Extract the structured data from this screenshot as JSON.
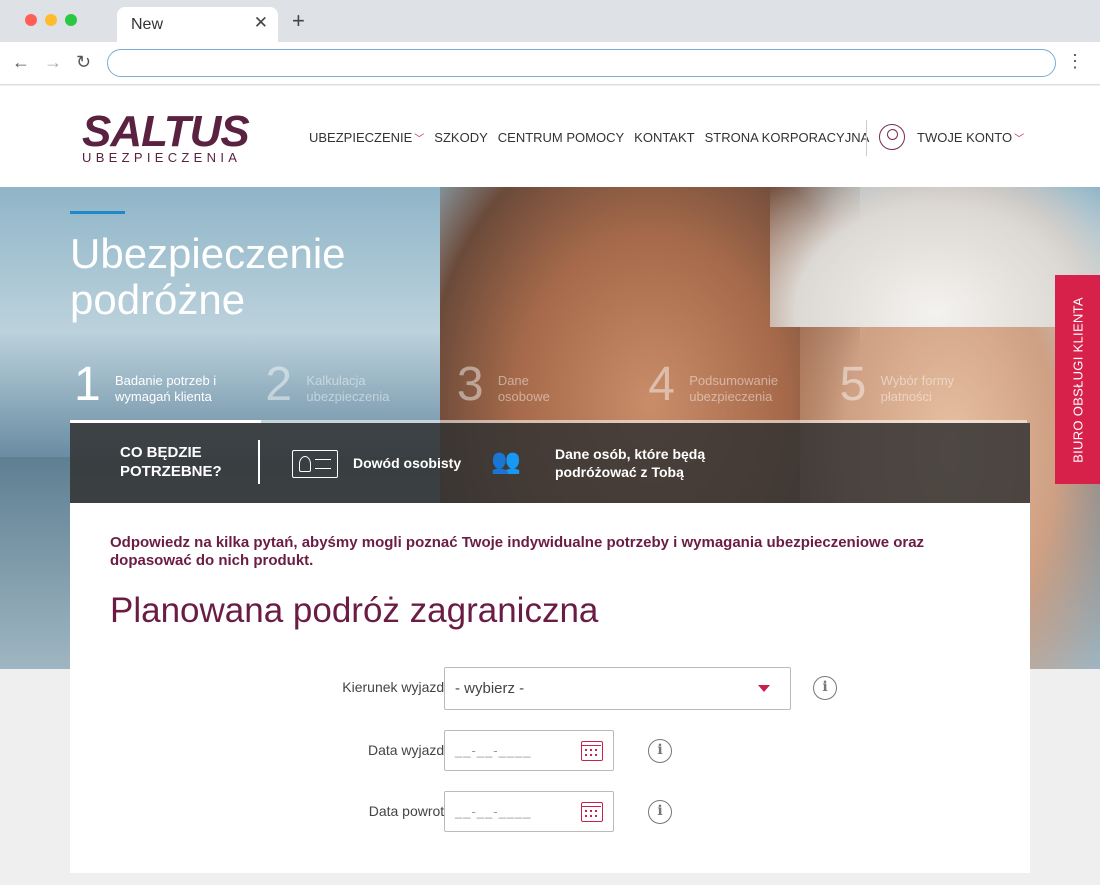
{
  "browser": {
    "tab_title": "New",
    "tab_close": "✕",
    "new_tab": "+",
    "back": "←",
    "forward": "→",
    "reload": "↻",
    "url": "",
    "menu": "⋮",
    "dot_colors": [
      "#ff5f57",
      "#febc2e",
      "#28c840"
    ]
  },
  "header": {
    "logo_main": "SALTUS",
    "logo_sub": "UBEZPIECZENIA",
    "nav": [
      {
        "label": "UBEZPIECZENIE",
        "has_dropdown": true
      },
      {
        "label": "SZKODY"
      },
      {
        "label": "CENTRUM POMOCY"
      },
      {
        "label": "KONTAKT"
      },
      {
        "label": "STRONA KORPORACYJNA"
      }
    ],
    "account_label": "TWOJE KONTO"
  },
  "hero": {
    "title": "Ubezpieczenie podróżne",
    "steps": [
      {
        "num": "1",
        "label": "Badanie potrzeb i wymagań klienta",
        "active": true
      },
      {
        "num": "2",
        "label": "Kalkulacja ubezpieczenia"
      },
      {
        "num": "3",
        "label": "Dane osobowe"
      },
      {
        "num": "4",
        "label": "Podsumowanie ubezpieczenia"
      },
      {
        "num": "5",
        "label": "Wybór formy płatności"
      }
    ],
    "needs_title": "CO BĘDZIE POTRZEBNE?",
    "need_id": "Dowód osobisty",
    "need_people": "Dane osób, które będą podróżować z Tobą"
  },
  "side_tab": "BIURO OBSŁUGI KLIENTA",
  "main": {
    "intro": "Odpowiedz na kilka pytań, abyśmy mogli poznać Twoje indywidualne potrzeby i wymagania ubezpieczeniowe oraz dopasować do nich produkt.",
    "section_title": "Planowana podróż zagraniczna",
    "fields": {
      "direction_label": "Kierunek wyjazdu",
      "direction_value": "- wybierz -",
      "departure_label": "Data wyjazdu",
      "departure_placeholder": "__-__-____",
      "return_label": "Data powrotu",
      "return_placeholder": "__-__-____",
      "info_glyph": "i"
    }
  },
  "colors": {
    "brand": "#5a2141",
    "accent": "#c8214e",
    "side_tab": "#d7214b",
    "step_line": "#1f88c9"
  }
}
